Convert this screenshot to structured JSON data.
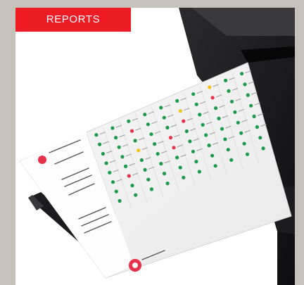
{
  "badge": {
    "label": "REPORTS",
    "color": "#ed1c24"
  },
  "photo": {
    "subject": "printer-with-printed-report-sheet",
    "report_logo_text": "",
    "dot_colors": {
      "ok": "#1a9a4a",
      "warning": "#f2c417",
      "fail": "#e8314b"
    }
  }
}
